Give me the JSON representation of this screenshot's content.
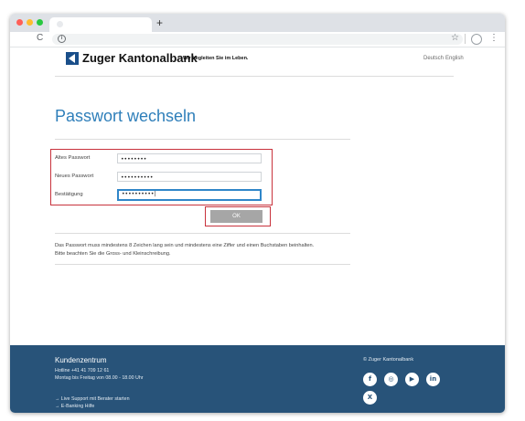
{
  "browser": {
    "new_tab_symbol": "+",
    "reload_symbol": "C",
    "info_symbol": "i",
    "star_symbol": "☆",
    "menu_symbol": "⋮"
  },
  "header": {
    "brand": "Zuger Kantonalbank",
    "tagline": "Wir begleiten Sie im Leben.",
    "lang_de": "Deutsch",
    "lang_en": "English"
  },
  "main": {
    "title": "Passwort wechseln",
    "fields": [
      {
        "label": "Altes Passwort",
        "value": "••••••••"
      },
      {
        "label": "Neues Passwort",
        "value": "••••••••••"
      },
      {
        "label": "Bestätigung",
        "value": "••••••••••|"
      }
    ],
    "ok_label": "OK",
    "info_line1": "Das Passwort muss mindestens 8 Zeichen lang sein und mindestens eine Ziffer und einen Buchstaben beinhalten.",
    "info_line2": "Bitte beachten Sie die Gross- und Kleinschreibung."
  },
  "footer": {
    "title": "Kundenzentrum",
    "hotline": "Hotline +41 41 709 12 61",
    "hours": "Montag bis Freitag von 08.00 - 18.00 Uhr",
    "link1": "→ Live Support mit Berater starten",
    "link2": "→ E-Banking Hilfe",
    "copyright": "© Zuger Kantonalbank",
    "social": [
      "f",
      "◎",
      "▶",
      "in",
      "X"
    ]
  },
  "icons": [
    "info-icon",
    "star-icon",
    "profile-icon",
    "menu-icon",
    "reload-icon",
    "facebook-icon",
    "instagram-icon",
    "youtube-icon",
    "linkedin-icon",
    "x-icon"
  ],
  "colors": {
    "brand_blue": "#1a4f8a",
    "title_blue": "#2f7fba",
    "footer_bg": "#285379",
    "highlight_red": "#c8323c",
    "focus_blue": "#2f86c9",
    "button_gray": "#a6a6a6"
  }
}
